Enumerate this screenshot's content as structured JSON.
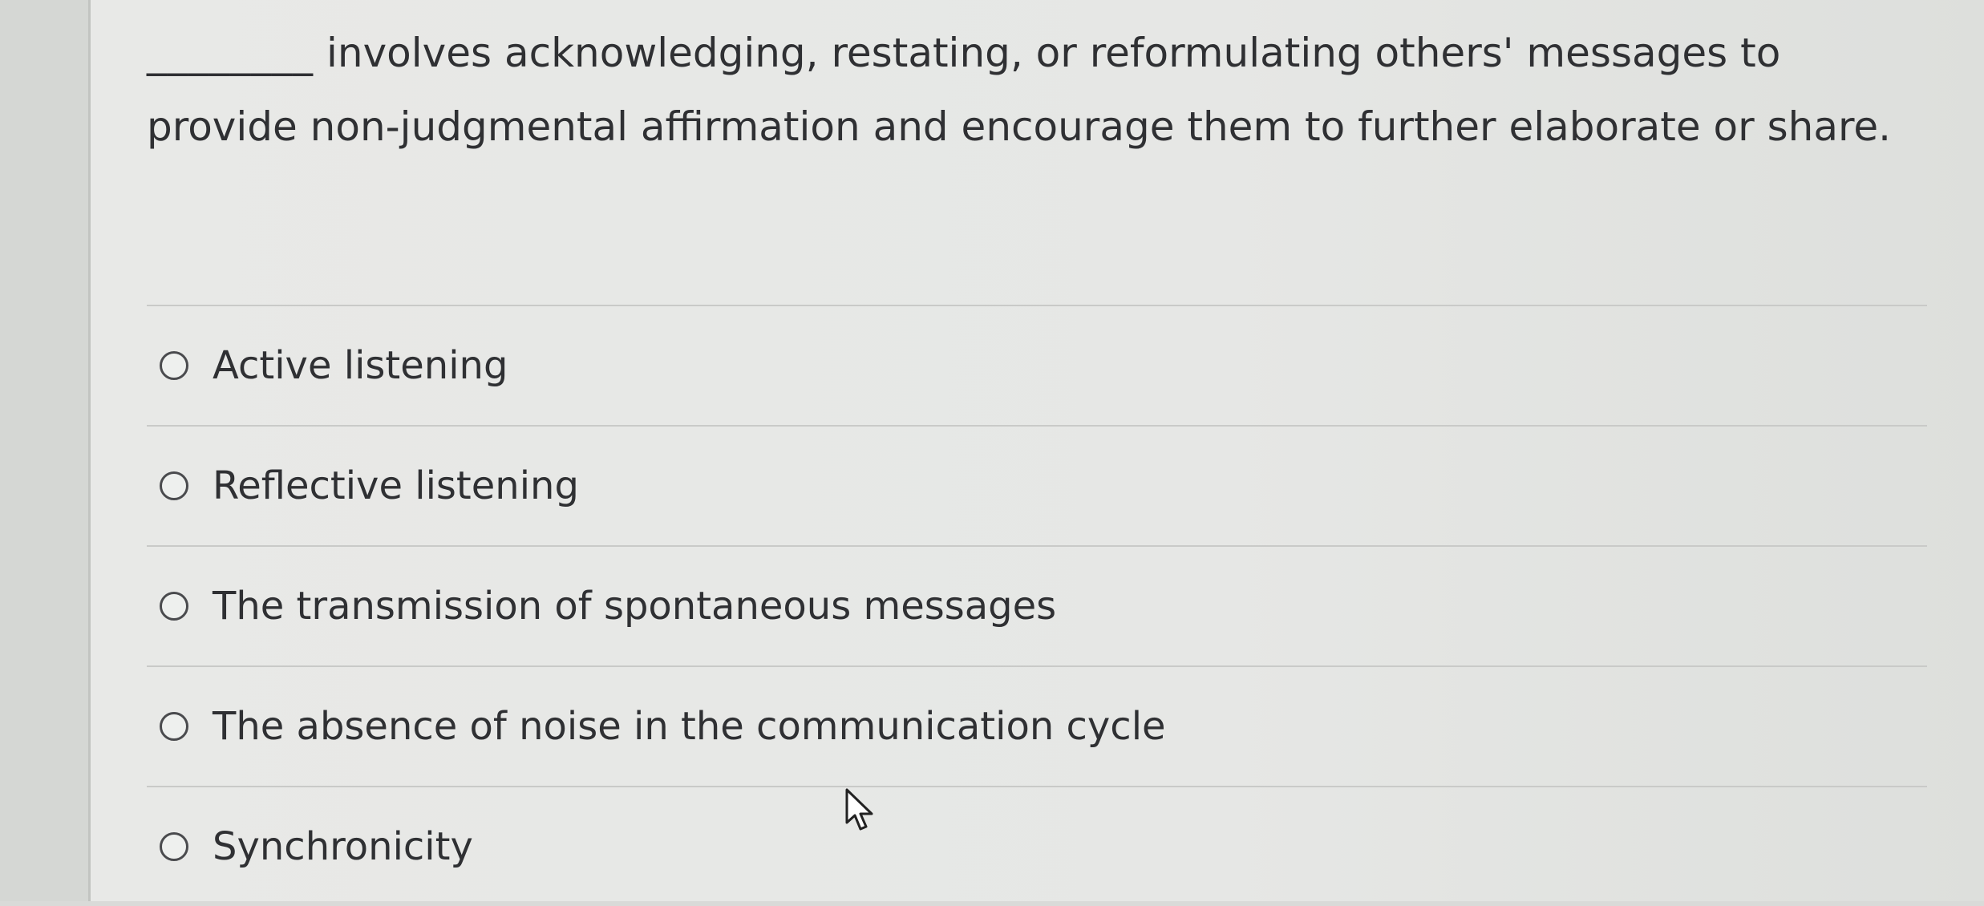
{
  "question": {
    "blank": "________",
    "text": "involves acknowledging, restating, or reformulating others' messages to provide non-judgmental affirmation and encourage them to further elaborate or share."
  },
  "options": [
    {
      "label": "Active listening",
      "selected": false
    },
    {
      "label": "Reflective listening",
      "selected": false
    },
    {
      "label": "The transmission of spontaneous messages",
      "selected": false
    },
    {
      "label": "The absence of noise in the communication cycle",
      "selected": false
    },
    {
      "label": "Synchronicity",
      "selected": false
    }
  ],
  "icons": {
    "radio": "radio-unselected-icon",
    "cursor": "mouse-pointer-icon"
  },
  "colors": {
    "text": "#2f3033",
    "divider": "#c9cac8",
    "background": "#e7e8e6"
  }
}
